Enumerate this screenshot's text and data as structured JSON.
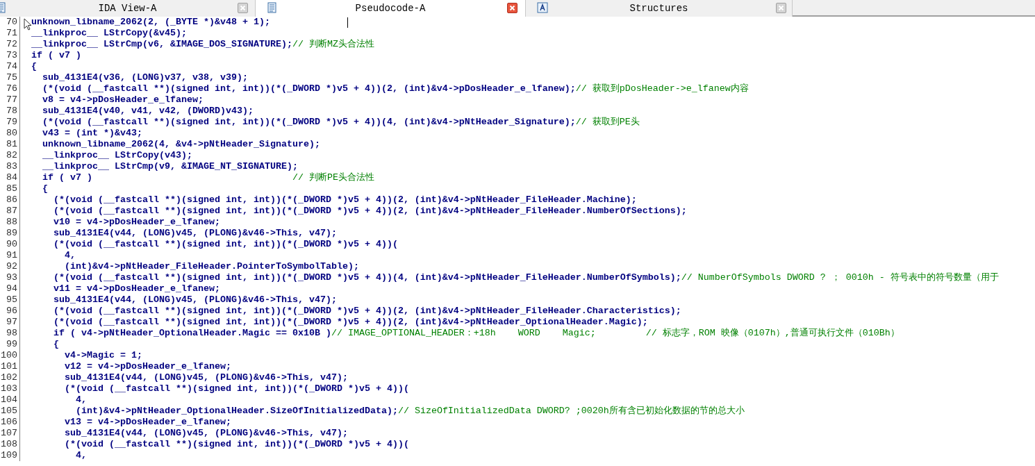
{
  "tabs": [
    {
      "label": "IDA View-A",
      "selected": false,
      "kind": "disassembly"
    },
    {
      "label": "Pseudocode-A",
      "selected": true,
      "kind": "pseudocode"
    },
    {
      "label": "Structures",
      "selected": false,
      "kind": "structures"
    }
  ],
  "lines": [
    {
      "number": "70",
      "code": "unknown_libname_2062(2, (_BYTE *)&v48 + 1);"
    },
    {
      "number": "71",
      "code": "__linkproc__ LStrCopy(&v45);"
    },
    {
      "number": "72",
      "code": "__linkproc__ LStrCmp(v6, &IMAGE_DOS_SIGNATURE);",
      "comment": "// 判断MZ头合法性"
    },
    {
      "number": "73",
      "code": "if ( v7 )"
    },
    {
      "number": "74",
      "code": "{"
    },
    {
      "number": "75",
      "code": "  sub_4131E4(v36, (LONG)v37, v38, v39);"
    },
    {
      "number": "76",
      "code": "  (*(void (__fastcall **)(signed int, int))(*(_DWORD *)v5 + 4))(2, (int)&v4->pDosHeader_e_lfanew);",
      "comment": "// 获取到pDosHeader->e_lfanew内容"
    },
    {
      "number": "77",
      "code": "  v8 = v4->pDosHeader_e_lfanew;"
    },
    {
      "number": "78",
      "code": "  sub_4131E4(v40, v41, v42, (DWORD)v43);"
    },
    {
      "number": "79",
      "code": "  (*(void (__fastcall **)(signed int, int))(*(_DWORD *)v5 + 4))(4, (int)&v4->pNtHeader_Signature);",
      "comment": "// 获取到PE头"
    },
    {
      "number": "80",
      "code": "  v43 = (int *)&v43;"
    },
    {
      "number": "81",
      "code": "  unknown_libname_2062(4, &v4->pNtHeader_Signature);"
    },
    {
      "number": "82",
      "code": "  __linkproc__ LStrCopy(v43);"
    },
    {
      "number": "83",
      "code": "  __linkproc__ LStrCmp(v9, &IMAGE_NT_SIGNATURE);"
    },
    {
      "number": "84",
      "code": "  if ( v7 )                                    ",
      "comment": "// 判断PE头合法性"
    },
    {
      "number": "85",
      "code": "  {"
    },
    {
      "number": "86",
      "code": "    (*(void (__fastcall **)(signed int, int))(*(_DWORD *)v5 + 4))(2, (int)&v4->pNtHeader_FileHeader.Machine);"
    },
    {
      "number": "87",
      "code": "    (*(void (__fastcall **)(signed int, int))(*(_DWORD *)v5 + 4))(2, (int)&v4->pNtHeader_FileHeader.NumberOfSections);"
    },
    {
      "number": "88",
      "code": "    v10 = v4->pDosHeader_e_lfanew;"
    },
    {
      "number": "89",
      "code": "    sub_4131E4(v44, (LONG)v45, (PLONG)&v46->This, v47);"
    },
    {
      "number": "90",
      "code": "    (*(void (__fastcall **)(signed int, int))(*(_DWORD *)v5 + 4))("
    },
    {
      "number": "91",
      "code": "      4,"
    },
    {
      "number": "92",
      "code": "      (int)&v4->pNtHeader_FileHeader.PointerToSymbolTable);"
    },
    {
      "number": "93",
      "code": "    (*(void (__fastcall **)(signed int, int))(*(_DWORD *)v5 + 4))(4, (int)&v4->pNtHeader_FileHeader.NumberOfSymbols);",
      "comment": "// NumberOfSymbols DWORD ? ； 0010h - 符号表中的符号数量（用于"
    },
    {
      "number": "94",
      "code": "    v11 = v4->pDosHeader_e_lfanew;"
    },
    {
      "number": "95",
      "code": "    sub_4131E4(v44, (LONG)v45, (PLONG)&v46->This, v47);"
    },
    {
      "number": "96",
      "code": "    (*(void (__fastcall **)(signed int, int))(*(_DWORD *)v5 + 4))(2, (int)&v4->pNtHeader_FileHeader.Characteristics);"
    },
    {
      "number": "97",
      "code": "    (*(void (__fastcall **)(signed int, int))(*(_DWORD *)v5 + 4))(2, (int)&v4->pNtHeader_OptionalHeader.Magic);"
    },
    {
      "number": "98",
      "code": "    if ( v4->pNtHeader_OptionalHeader.Magic == 0x10B )",
      "comment": "// IMAGE_OPTIONAL_HEADER：+18h    WORD    Magic;         // 标志字，ROM 映像（0107h）,普通可执行文件（010Bh）"
    },
    {
      "number": "99",
      "code": "    {"
    },
    {
      "number": "100",
      "code": "      v4->Magic = 1;"
    },
    {
      "number": "101",
      "code": "      v12 = v4->pDosHeader_e_lfanew;"
    },
    {
      "number": "102",
      "code": "      sub_4131E4(v44, (LONG)v45, (PLONG)&v46->This, v47);"
    },
    {
      "number": "103",
      "code": "      (*(void (__fastcall **)(signed int, int))(*(_DWORD *)v5 + 4))("
    },
    {
      "number": "104",
      "code": "        4,"
    },
    {
      "number": "105",
      "code": "        (int)&v4->pNtHeader_OptionalHeader.SizeOfInitializedData);",
      "comment": "// SizeOfInitializedData DWORD? ;0020h所有含已初始化数据的节的总大小"
    },
    {
      "number": "106",
      "code": "      v13 = v4->pDosHeader_e_lfanew;"
    },
    {
      "number": "107",
      "code": "      sub_4131E4(v44, (LONG)v45, (PLONG)&v46->This, v47);"
    },
    {
      "number": "108",
      "code": "      (*(void (__fastcall **)(signed int, int))(*(_DWORD *)v5 + 4))("
    },
    {
      "number": "109",
      "code": "        4,"
    }
  ]
}
